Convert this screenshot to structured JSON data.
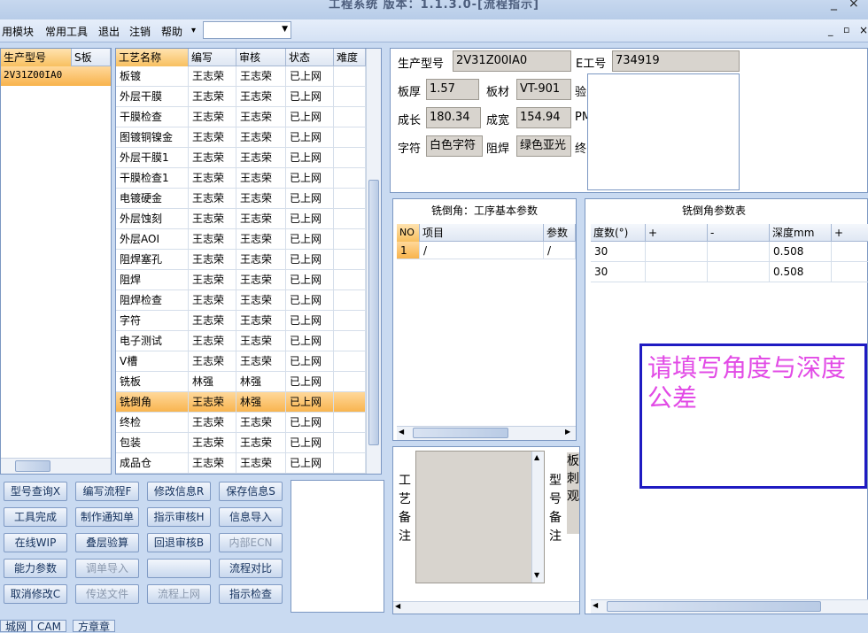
{
  "window": {
    "title": "工程系统 版本：1.1.3.0-[流程指示]",
    "min": "_",
    "restore": "▫",
    "close": "×"
  },
  "menu": [
    "用模块",
    "常用工具",
    "退出",
    "注销",
    "帮助"
  ],
  "menu_arrow": "▾",
  "left_list": {
    "headers": [
      "生产型号",
      "S板"
    ],
    "rows": [
      [
        "2V31Z00IA0",
        ""
      ]
    ]
  },
  "process": {
    "headers": [
      "工艺名称",
      "编写",
      "审核",
      "状态",
      "难度"
    ],
    "rows": [
      [
        "板镀",
        "王志荣",
        "王志荣",
        "已上网"
      ],
      [
        "外层干膜",
        "王志荣",
        "王志荣",
        "已上网"
      ],
      [
        "干膜检查",
        "王志荣",
        "王志荣",
        "已上网"
      ],
      [
        "图镀铜镍金",
        "王志荣",
        "王志荣",
        "已上网"
      ],
      [
        "外层干膜1",
        "王志荣",
        "王志荣",
        "已上网"
      ],
      [
        "干膜检查1",
        "王志荣",
        "王志荣",
        "已上网"
      ],
      [
        "电镀硬金",
        "王志荣",
        "王志荣",
        "已上网"
      ],
      [
        "外层蚀刻",
        "王志荣",
        "王志荣",
        "已上网"
      ],
      [
        "外层AOI",
        "王志荣",
        "王志荣",
        "已上网"
      ],
      [
        "阻焊塞孔",
        "王志荣",
        "王志荣",
        "已上网"
      ],
      [
        "阻焊",
        "王志荣",
        "王志荣",
        "已上网"
      ],
      [
        "阻焊检查",
        "王志荣",
        "王志荣",
        "已上网"
      ],
      [
        "字符",
        "王志荣",
        "王志荣",
        "已上网"
      ],
      [
        "电子测试",
        "王志荣",
        "王志荣",
        "已上网"
      ],
      [
        "V槽",
        "王志荣",
        "王志荣",
        "已上网"
      ],
      [
        "铣板",
        "林强",
        "林强",
        "已上网"
      ],
      [
        "铣倒角",
        "王志荣",
        "林强",
        "已上网"
      ],
      [
        "终检",
        "王志荣",
        "王志荣",
        "已上网"
      ],
      [
        "包装",
        "王志荣",
        "王志荣",
        "已上网"
      ],
      [
        "成品仓",
        "王志荣",
        "王志荣",
        "已上网"
      ]
    ],
    "selected_index": 16
  },
  "buttons": [
    {
      "label": "型号查询X",
      "enabled": true
    },
    {
      "label": "编写流程F",
      "enabled": true
    },
    {
      "label": "修改信息R",
      "enabled": true
    },
    {
      "label": "保存信息S",
      "enabled": true
    },
    {
      "label": "工具完成",
      "enabled": true
    },
    {
      "label": "制作通知单",
      "enabled": true
    },
    {
      "label": "指示审核H",
      "enabled": true
    },
    {
      "label": "信息导入",
      "enabled": true
    },
    {
      "label": "在线WIP",
      "enabled": true
    },
    {
      "label": "叠层验算",
      "enabled": true
    },
    {
      "label": "回退审核B",
      "enabled": true
    },
    {
      "label": "内部ECN",
      "enabled": false
    },
    {
      "label": "能力参数",
      "enabled": true
    },
    {
      "label": "调单导入",
      "enabled": false
    },
    {
      "label": "",
      "enabled": true
    },
    {
      "label": "流程对比",
      "enabled": true
    },
    {
      "label": "取消修改C",
      "enabled": true
    },
    {
      "label": "传送文件",
      "enabled": false
    },
    {
      "label": "流程上网",
      "enabled": false
    },
    {
      "label": "指示检查",
      "enabled": true
    }
  ],
  "info": {
    "model_label": "生产型号",
    "model": "2V31Z00IA0",
    "eno_label": "E工号",
    "eno": "734919",
    "thick_label": "板厚",
    "thick": "1.57",
    "mat_label": "板材",
    "mat": "VT-901",
    "check_label": "验",
    "len_label": "成长",
    "len": "180.34",
    "wid_label": "成宽",
    "wid": "154.94",
    "pm_label": "PM",
    "char_label": "字符",
    "char": "白色字符",
    "mask_label": "阻焊",
    "mask": "绿色亚光",
    "final_label": "终"
  },
  "base_params": {
    "title": "铣倒角：工序基本参数",
    "headers": [
      "NO",
      "项目",
      "参数"
    ],
    "rows": [
      [
        "1",
        "/",
        "/"
      ]
    ]
  },
  "angle_params": {
    "title": "铣倒角参数表",
    "headers": [
      "度数(°)",
      "+",
      "-",
      "深度mm",
      "+"
    ],
    "rows": [
      [
        "30",
        "",
        "",
        "0.508",
        ""
      ],
      [
        "30",
        "",
        "",
        "0.508",
        ""
      ]
    ]
  },
  "notice": "请填写角度与深度公差",
  "remark": {
    "label": "工艺备注",
    "model_label": "型号备注",
    "right_text": "板刺观"
  },
  "tabs": [
    "城网",
    "CAM",
    "方章章"
  ]
}
